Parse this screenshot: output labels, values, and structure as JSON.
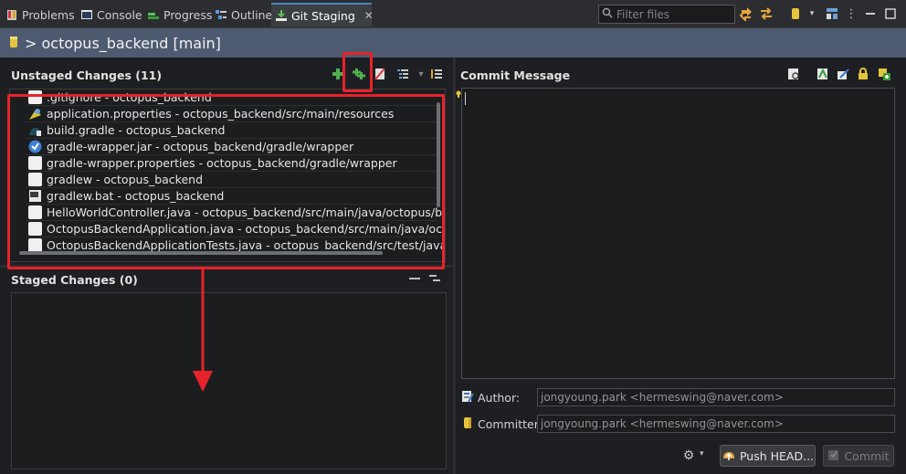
{
  "tabs": [
    {
      "label": "Problems",
      "icon": "problems-icon"
    },
    {
      "label": "Console",
      "icon": "console-icon"
    },
    {
      "label": "Progress",
      "icon": "progress-icon"
    },
    {
      "label": "Outline",
      "icon": "outline-icon"
    },
    {
      "label": "Git Staging",
      "icon": "git-staging-icon",
      "active": true
    }
  ],
  "filter": {
    "placeholder": "Filter files"
  },
  "repo": {
    "title": "> octopus_backend [main]"
  },
  "unstaged": {
    "header": "Unstaged Changes (11)",
    "files": [
      {
        "name": ".gitignore - octopus_backend",
        "icon": "text-file-icon"
      },
      {
        "name": "application.properties - octopus_backend/src/main/resources",
        "icon": "properties-file-icon"
      },
      {
        "name": "build.gradle - octopus_backend",
        "icon": "gradle-file-icon"
      },
      {
        "name": "gradle-wrapper.jar - octopus_backend/gradle/wrapper",
        "icon": "jar-file-icon"
      },
      {
        "name": "gradle-wrapper.properties - octopus_backend/gradle/wrapper",
        "icon": "text-file-icon"
      },
      {
        "name": "gradlew - octopus_backend",
        "icon": "text-file-icon"
      },
      {
        "name": "gradlew.bat - octopus_backend",
        "icon": "bat-file-icon"
      },
      {
        "name": "HelloWorldController.java - octopus_backend/src/main/java/octopus/backend",
        "icon": "java-file-icon"
      },
      {
        "name": "OctopusBackendApplication.java - octopus_backend/src/main/java/octopus/b",
        "icon": "java-file-icon"
      },
      {
        "name": "OctopusBackendApplicationTests.java - octopus_backend/src/test/java/octopu",
        "icon": "java-file-icon"
      }
    ]
  },
  "staged": {
    "header": "Staged Changes (0)"
  },
  "commit": {
    "header": "Commit Message",
    "author_label": "Author:",
    "author_value": "jongyoung.park <hermeswing@naver.com>",
    "committer_label": "Committer:",
    "committer_value": "jongyoung.park <hermeswing@naver.com>",
    "push_label": "Push HEAD...",
    "commit_label": "Commit"
  },
  "colors": {
    "annotation": "#e8222a",
    "accent": "#4a88c7",
    "repo_header": "#4e5a70"
  }
}
